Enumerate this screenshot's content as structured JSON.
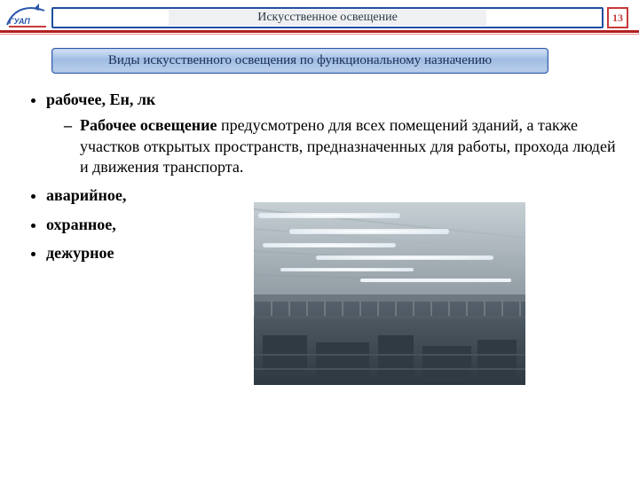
{
  "header": {
    "logo_text": "ГУАП",
    "title": "Искусственное освещение",
    "page_number": "13"
  },
  "subheader": "Виды искусственного освещения по функциональному назначению",
  "bullets": {
    "b1": "рабочее, Ен, лк",
    "b1_sub_bold": "Рабочее освещение",
    "b1_sub_rest": " предусмотрено для всех помещений зданий, а также участков открытых пространств, предназначенных для работы, прохода людей и движения транспорта.",
    "b2": "аварийное,",
    "b3": "охранное,",
    "b4": "дежурное"
  }
}
